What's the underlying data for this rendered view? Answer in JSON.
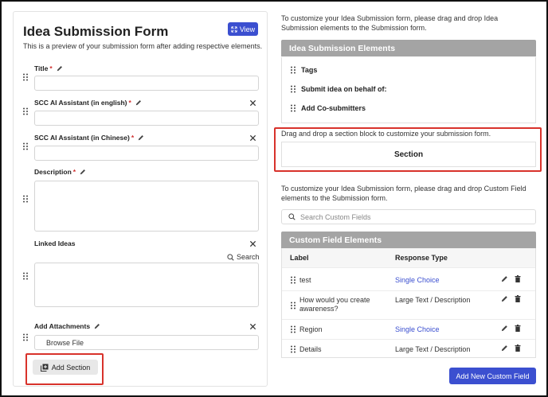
{
  "form": {
    "title": "Idea Submission Form",
    "view_label": "View",
    "subtitle": "This is a preview of your submission form after adding respective elements.",
    "fields": [
      {
        "label": "Title",
        "required": "*"
      },
      {
        "label": "SCC AI Assistant (in english)",
        "required": " *"
      },
      {
        "label": "SCC AI Assistant (in Chinese)",
        "required": " *"
      },
      {
        "label": "Description",
        "required": "*"
      },
      {
        "label": "Linked Ideas",
        "required": ""
      },
      {
        "label": "Add Attachments",
        "required": ""
      }
    ],
    "linked_search_label": "Search",
    "browse_label": "Browse File",
    "add_section_label": "Add Section"
  },
  "elements": {
    "intro": "To customize your Idea Submission form, please drag and drop Idea Submission elements to the Submission form.",
    "header": "Idea Submission Elements",
    "items": [
      "Tags",
      "Submit idea on behalf of:",
      "Add Co-submitters"
    ]
  },
  "section": {
    "hint": "Drag and drop a section block to customize your submission form.",
    "block_label": "Section"
  },
  "custom_fields": {
    "intro": "To customize your Idea Submission form, please drag and drop Custom Field elements to the Submission form.",
    "search_placeholder": "Search Custom Fields",
    "header": "Custom Field Elements",
    "col_label": "Label",
    "col_type": "Response Type",
    "rows": [
      {
        "label": "test",
        "type": "Single Choice"
      },
      {
        "label": "How would you create awareness?",
        "type": "Large Text / Description"
      },
      {
        "label": "Region",
        "type": "Single Choice"
      },
      {
        "label": "Details",
        "type": "Large Text / Description"
      }
    ],
    "add_button": "Add New Custom Field"
  },
  "colors": {
    "accent": "#3b4fd0",
    "highlight": "#d8322b",
    "panel_header": "#a4a4a4",
    "required": "#d0302f"
  }
}
